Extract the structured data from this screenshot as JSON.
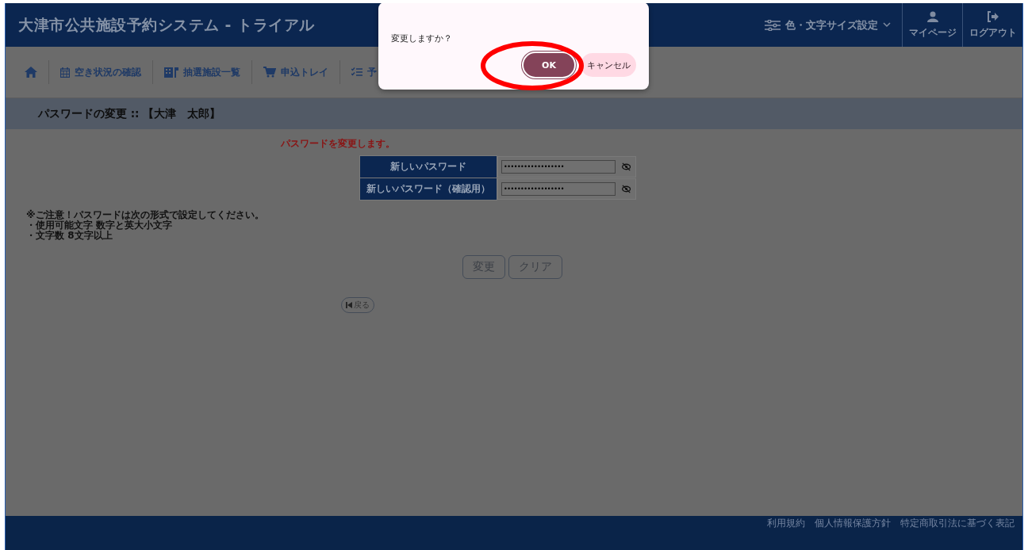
{
  "header": {
    "title": "大津市公共施設予約システム - トライアル",
    "settings_menu": "色・文字サイズ設定",
    "user_buttons": [
      {
        "kind": "user",
        "label": "マイページ"
      },
      {
        "kind": "logout",
        "label": "ログアウト"
      }
    ]
  },
  "nav": {
    "items": [
      {
        "kind": "home"
      },
      {
        "kind": "calendar",
        "label": "空き状況の確認"
      },
      {
        "kind": "building",
        "label": "抽選施設一覧"
      },
      {
        "kind": "cart",
        "label": "申込トレイ"
      },
      {
        "kind": "list",
        "label": "予"
      }
    ]
  },
  "page_title": "パスワードの変更 :: 【大津　太郎】",
  "message": "パスワードを変更します。",
  "form": {
    "rows": [
      {
        "label": "新しいパスワード",
        "value": "••••••••••••••••••"
      },
      {
        "label": "新しいパスワード（確認用）",
        "value": "••••••••••••••••••"
      }
    ]
  },
  "notes": [
    "※ご注意！パスワードは次の形式で設定してください。",
    "・使用可能文字 数字と英大小文字",
    "・文字数 8文字以上"
  ],
  "buttons": [
    "変更",
    "クリア"
  ],
  "back": "戻る",
  "footer": {
    "links": [
      "利用規約",
      "個人情報保護方針",
      "特定商取引法に基づく表記"
    ]
  },
  "dialog": {
    "message": "変更しますか？",
    "buttons": [
      {
        "kind": "primary",
        "label": "OK"
      },
      {
        "kind": "secondary",
        "label": "キャンセル"
      }
    ]
  }
}
